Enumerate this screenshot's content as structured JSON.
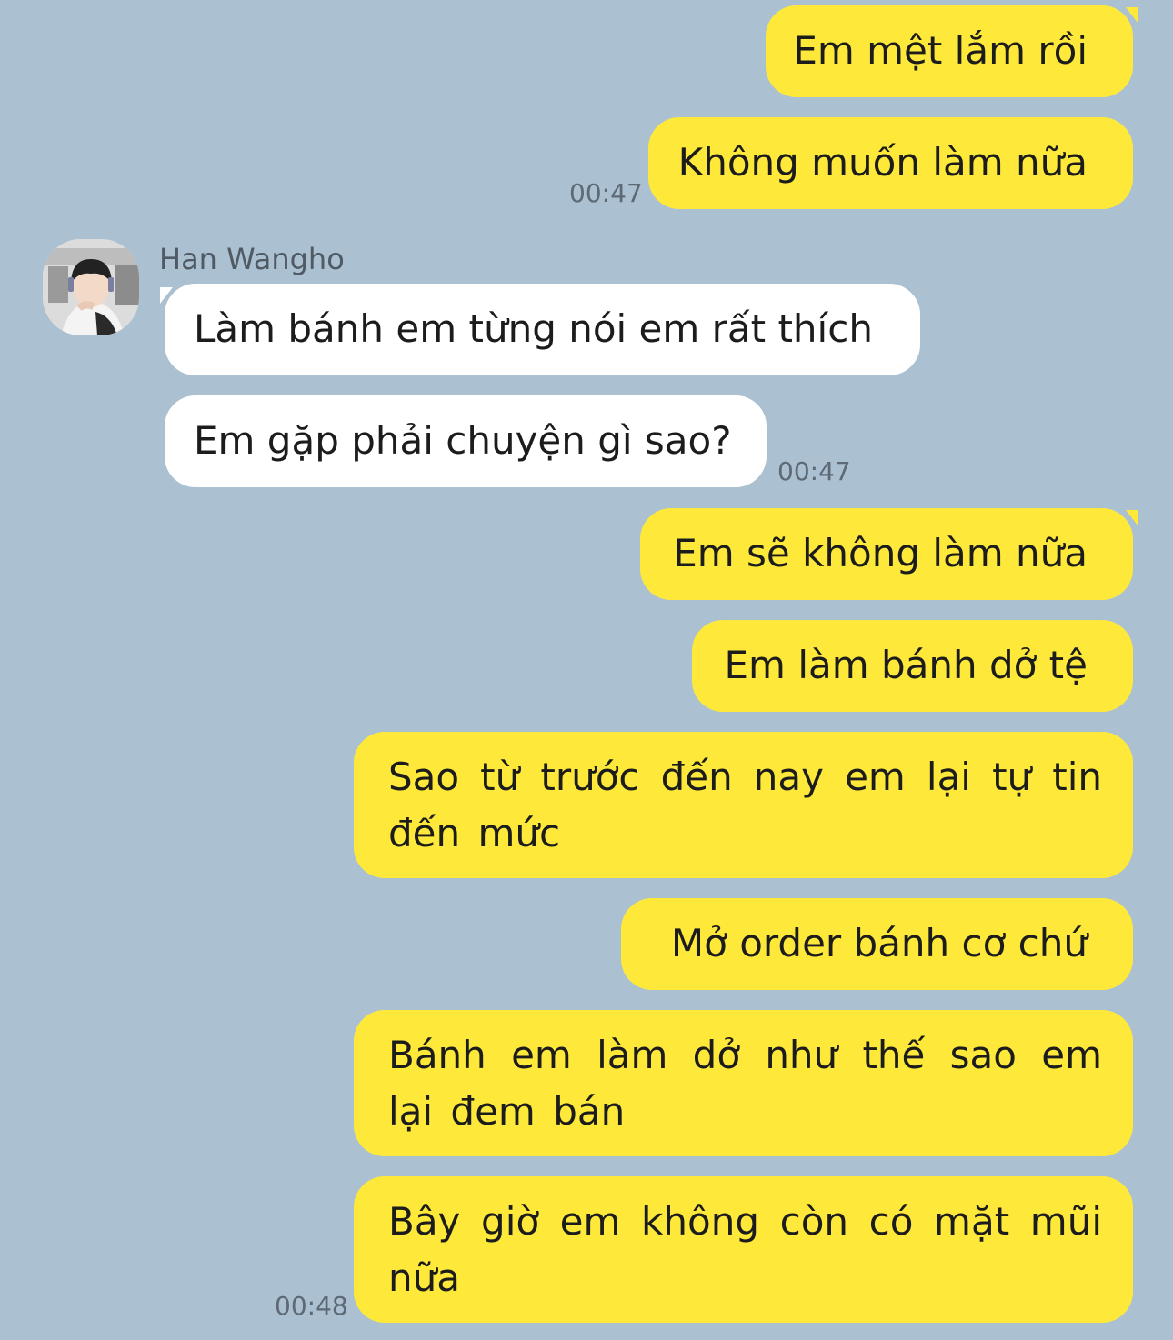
{
  "chat": {
    "contact_name": "Han Wangho",
    "messages": [
      {
        "text": "Em mệt lắm rồi"
      },
      {
        "text": "Không muốn làm nữa",
        "time": "00:47"
      },
      {
        "text": "Làm bánh em từng nói em rất thích"
      },
      {
        "text": "Em gặp phải chuyện gì sao?",
        "time": "00:47"
      },
      {
        "text": "Em sẽ không làm nữa"
      },
      {
        "text": "Em làm bánh dở tệ"
      },
      {
        "text": "Sao từ trước đến nay em lại tự tin đến mức"
      },
      {
        "text": "Mở order bánh cơ chứ"
      },
      {
        "text": "Bánh em làm dở như thế sao em lại đem bán"
      },
      {
        "text": "Bây giờ em không còn có mặt mũi nữa",
        "time": "00:48"
      }
    ]
  },
  "colors": {
    "background": "#abc1d1",
    "outgoing_bubble": "#fee93a",
    "incoming_bubble": "#ffffff"
  }
}
